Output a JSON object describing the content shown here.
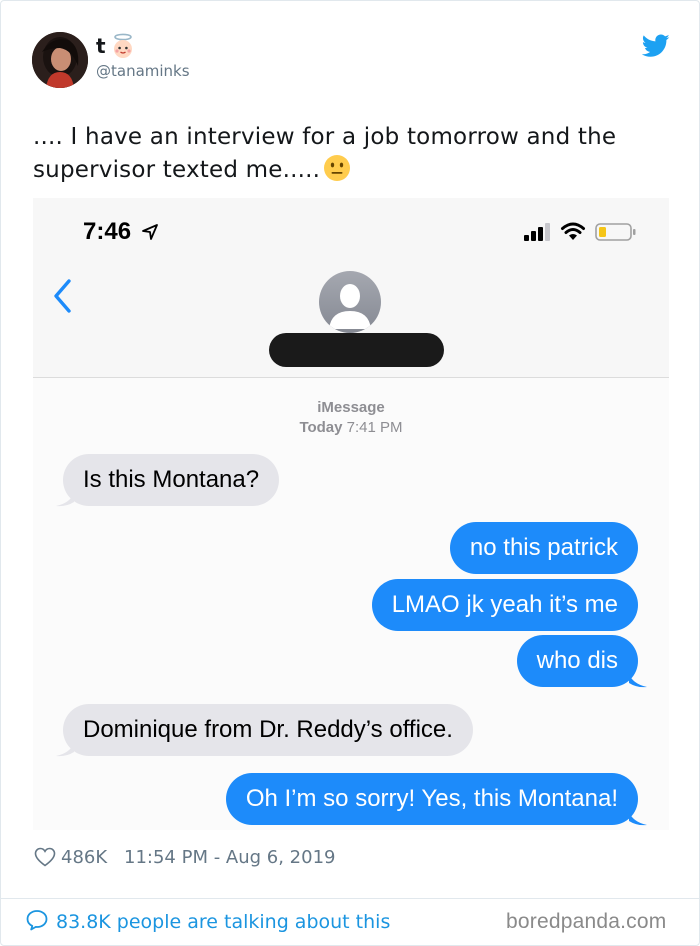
{
  "user": {
    "name": "t",
    "handle": "@tanaminks"
  },
  "tweet": {
    "text": ".... I have an interview for a job tomorrow and the supervisor texted me.....",
    "likes": "486K",
    "date": "11:54 PM - Aug 6, 2019",
    "talking": "83.8K people are talking about this"
  },
  "phone": {
    "status_time": "7:46",
    "service_label": "iMessage",
    "timestamp_day": "Today",
    "timestamp_time": "7:41 PM",
    "messages": [
      {
        "from": "them",
        "text": "Is this Montana?"
      },
      {
        "from": "me",
        "text": "no this patrick"
      },
      {
        "from": "me",
        "text": "LMAO jk yeah it’s me"
      },
      {
        "from": "me",
        "text": "who dis"
      },
      {
        "from": "them",
        "text": "Dominique from Dr. Reddy’s office."
      },
      {
        "from": "me",
        "text": "Oh I’m so sorry! Yes, this Montana!"
      }
    ]
  },
  "icons": {
    "angel": "angel-emoji-icon",
    "neutral_face": "neutral-face-emoji-icon",
    "twitter": "twitter-bird-icon",
    "heart": "heart-icon",
    "comment": "comment-bubble-icon"
  },
  "colors": {
    "twitter_blue": "#1da1f2",
    "imessage_blue": "#1d8bfa",
    "incoming_gray": "#e5e5ea",
    "meta_gray": "#657786"
  },
  "watermark": "boredpanda.com"
}
